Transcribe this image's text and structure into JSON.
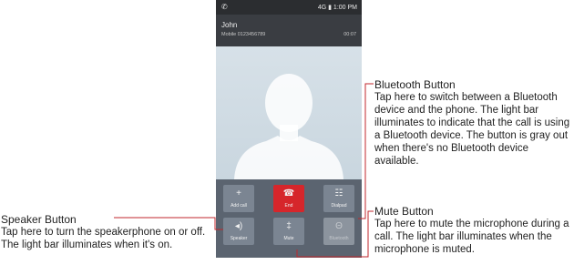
{
  "status_bar": {
    "left_icon": "phone-icon",
    "signal": "4G",
    "time": "1:00 PM"
  },
  "caller": {
    "name": "John",
    "subtitle": "Mobile 0123456789",
    "timer": "00:07"
  },
  "buttons": {
    "add_call": {
      "label": "Add call",
      "icon": "+"
    },
    "end": {
      "label": "End",
      "icon": "☎"
    },
    "dialpad": {
      "label": "Dialpad",
      "icon": "☷"
    },
    "speaker": {
      "label": "Speaker",
      "icon": "◂)"
    },
    "mute": {
      "label": "Mute",
      "icon": "‡"
    },
    "bluetooth": {
      "label": "Bluetooth",
      "icon": "Θ"
    }
  },
  "callouts": {
    "bluetooth": {
      "title": "Bluetooth Button",
      "text": "Tap here to switch between a Bluetooth device and the phone. The light bar illuminates to indicate that the call is using a Bluetooth device. The button is gray out when there's no Bluetooth device available."
    },
    "mute": {
      "title": "Mute Button",
      "text": "Tap here to mute the microphone during a call. The light bar illuminates when the microphone is muted."
    },
    "speaker": {
      "title": "Speaker Button",
      "text": "Tap here to turn the speakerphone on or off. The light bar illuminates when it's on."
    }
  },
  "colors": {
    "end_button": "#d6262b",
    "light_bar": "#8fd3ff",
    "callout_line": "#c0272d"
  }
}
